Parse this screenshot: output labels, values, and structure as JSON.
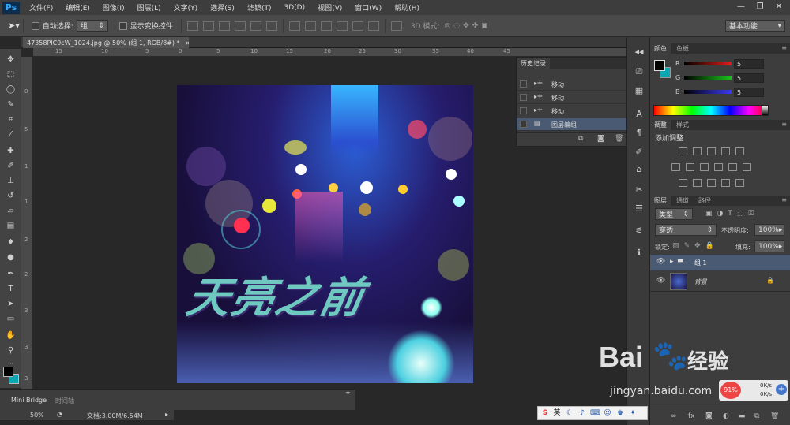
{
  "menubar": {
    "logo": "Ps",
    "items": [
      "文件(F)",
      "编辑(E)",
      "图像(I)",
      "图层(L)",
      "文字(Y)",
      "选择(S)",
      "滤镜(T)",
      "3D(D)",
      "视图(V)",
      "窗口(W)",
      "帮助(H)"
    ],
    "window_buttons": [
      "—",
      "❐",
      "✕"
    ]
  },
  "options": {
    "auto_select_label": "自动选择:",
    "auto_select_value": "组",
    "show_transform_label": "显示变换控件",
    "mode_3d_label": "3D 模式:",
    "workspace": "基本功能"
  },
  "document": {
    "tab_title": "47358PIC9cW_1024.jpg @ 50% (组 1, RGB/8#) *",
    "tab_close": "×",
    "art_text": "天亮之前",
    "ruler_top": [
      "15",
      "10",
      "5",
      "0",
      "5",
      "10",
      "15",
      "20",
      "25",
      "30",
      "35",
      "40",
      "45"
    ],
    "ruler_left": [
      "0",
      "5",
      "1",
      "1",
      "2",
      "2",
      "3",
      "3",
      "3"
    ]
  },
  "bottom": {
    "tabs": [
      "Mini Bridge",
      "时间轴"
    ],
    "zoom": "50%",
    "doc_info": "文档:3.00M/6.54M"
  },
  "history": {
    "title": "历史记录",
    "rows": [
      {
        "label": "移动",
        "selected": false
      },
      {
        "label": "移动",
        "selected": false
      },
      {
        "label": "移动",
        "selected": false
      },
      {
        "label": "图层编组",
        "selected": true
      }
    ]
  },
  "color_panel": {
    "tabs": [
      "颜色",
      "色板"
    ],
    "channels": [
      {
        "name": "R",
        "value": "5",
        "color": "#c21b1b"
      },
      {
        "name": "G",
        "value": "5",
        "color": "#1bb31b"
      },
      {
        "name": "B",
        "value": "5",
        "color": "#2b2bd4"
      }
    ],
    "foreground": "#000000",
    "background": "#0aa7b3"
  },
  "adjust_panel": {
    "tabs": [
      "调整",
      "样式"
    ],
    "title": "添加调整"
  },
  "layers_panel": {
    "tabs": [
      "图层",
      "通道",
      "路径"
    ],
    "filter": "类型",
    "blend_mode": "穿透",
    "opacity_label": "不透明度:",
    "opacity": "100%",
    "lock_label": "锁定:",
    "fill_label": "填充:",
    "fill": "100%",
    "layers": [
      {
        "name": "组 1",
        "kind": "group",
        "selected": true
      },
      {
        "name": "背景",
        "kind": "image",
        "selected": false
      }
    ]
  },
  "watermark": {
    "brand": "Bai",
    "brand2": "经验",
    "url": "jingyan.baidu.com"
  },
  "net_speed": {
    "percent": "91%",
    "up": "0K/s",
    "down": "0K/s"
  },
  "taskbar": {
    "ime": "英"
  }
}
